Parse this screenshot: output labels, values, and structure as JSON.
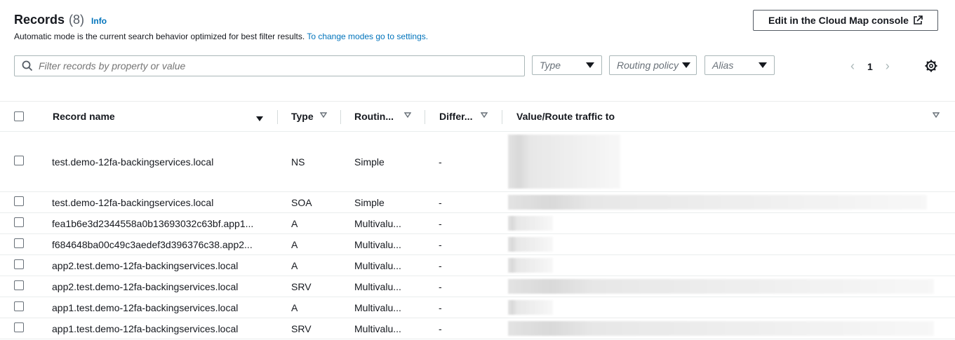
{
  "header": {
    "title": "Records",
    "count": "(8)",
    "info": "Info",
    "description": "Automatic mode is the current search behavior optimized for best filter results.",
    "description_link": "To change modes go to settings.",
    "edit_button": "Edit in the Cloud Map console"
  },
  "filters": {
    "search_placeholder": "Filter records by property or value",
    "type_placeholder": "Type",
    "routing_placeholder": "Routing policy",
    "alias_placeholder": "Alias"
  },
  "pagination": {
    "current_page": "1"
  },
  "table": {
    "columns": {
      "record_name": "Record name",
      "type": "Type",
      "routing": "Routin...",
      "differ": "Differ...",
      "value": "Value/Route traffic to"
    },
    "rows": [
      {
        "name": "test.demo-12fa-backingservices.local",
        "type": "NS",
        "routing": "Simple",
        "differ": "-"
      },
      {
        "name": "test.demo-12fa-backingservices.local",
        "type": "SOA",
        "routing": "Simple",
        "differ": "-"
      },
      {
        "name": "fea1b6e3d2344558a0b13693032c63bf.app1...",
        "type": "A",
        "routing": "Multivalu...",
        "differ": "-"
      },
      {
        "name": "f684648ba00c49c3aedef3d396376c38.app2...",
        "type": "A",
        "routing": "Multivalu...",
        "differ": "-"
      },
      {
        "name": "app2.test.demo-12fa-backingservices.local",
        "type": "A",
        "routing": "Multivalu...",
        "differ": "-"
      },
      {
        "name": "app2.test.demo-12fa-backingservices.local",
        "type": "SRV",
        "routing": "Multivalu...",
        "differ": "-"
      },
      {
        "name": "app1.test.demo-12fa-backingservices.local",
        "type": "A",
        "routing": "Multivalu...",
        "differ": "-"
      },
      {
        "name": "app1.test.demo-12fa-backingservices.local",
        "type": "SRV",
        "routing": "Multivalu...",
        "differ": "-"
      }
    ]
  },
  "colors": {
    "link": "#0073bb",
    "text": "#16191f",
    "border": "#aab7b8"
  }
}
